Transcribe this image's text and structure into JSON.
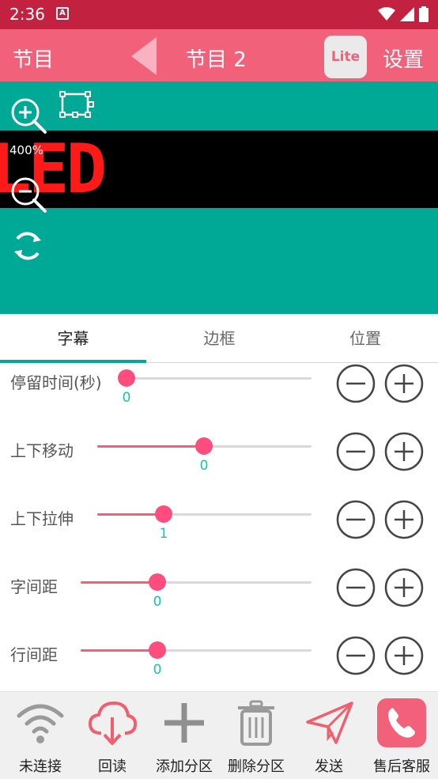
{
  "status_bar": {
    "time": "2:36",
    "notification_letter": "A"
  },
  "app_bar": {
    "left_label": "节目",
    "title": "节目 2",
    "lite_label": "Lite",
    "settings_label": "设置"
  },
  "preview": {
    "zoom_level": "400%",
    "led_text": "LED",
    "led_color": "#ff1a1a",
    "background_color": "#00a896"
  },
  "tabs": [
    {
      "label": "字幕",
      "active": true
    },
    {
      "label": "边框",
      "active": false
    },
    {
      "label": "位置",
      "active": false
    }
  ],
  "sliders": [
    {
      "label": "停留时间(秒)",
      "value": "0",
      "level": 0.0
    },
    {
      "label": "上下移动",
      "value": "0",
      "level": 0.5
    },
    {
      "label": "上下拉伸",
      "value": "1",
      "level": 0.3
    },
    {
      "label": "字间距",
      "value": "0",
      "level": 0.33
    },
    {
      "label": "行间距",
      "value": "0",
      "level": 0.33
    }
  ],
  "bottom_nav": [
    {
      "label": "未连接",
      "icon": "wifi-icon"
    },
    {
      "label": "回读",
      "icon": "cloud-download-icon"
    },
    {
      "label": "添加分区",
      "icon": "plus-icon"
    },
    {
      "label": "删除分区",
      "icon": "trash-icon"
    },
    {
      "label": "发送",
      "icon": "send-icon"
    },
    {
      "label": "售后客服",
      "icon": "phone-icon"
    }
  ],
  "colors": {
    "status_bar": "#c2213f",
    "app_bar": "#f2617a",
    "accent": "#00a896",
    "slider_thumb": "#ff4d7d",
    "value_text": "#19c2b0"
  }
}
